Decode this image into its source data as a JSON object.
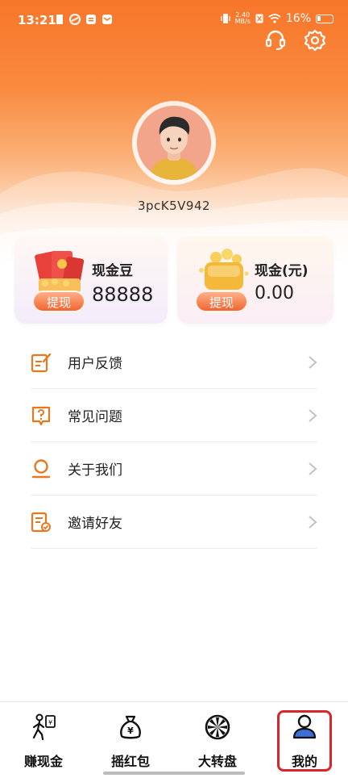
{
  "status_bar": {
    "time": "13:21",
    "net_speed_value": "2.40",
    "net_speed_unit": "MB/s",
    "battery": "16%"
  },
  "profile": {
    "username": "3pcK5V942"
  },
  "cards": {
    "beans": {
      "label": "现金豆",
      "value": "88888",
      "button": "提现"
    },
    "cash": {
      "label": "现金(元)",
      "value": "0.00",
      "button": "提现"
    }
  },
  "menu": {
    "items": [
      {
        "label": "用户反馈",
        "icon": "feedback-icon"
      },
      {
        "label": "常见问题",
        "icon": "faq-icon"
      },
      {
        "label": "关于我们",
        "icon": "about-icon"
      },
      {
        "label": "邀请好友",
        "icon": "invite-icon"
      }
    ]
  },
  "nav": {
    "items": [
      {
        "label": "赚现金",
        "icon": "walking-person-icon"
      },
      {
        "label": "摇红包",
        "icon": "money-bag-icon"
      },
      {
        "label": "大转盘",
        "icon": "wheel-icon"
      },
      {
        "label": "我的",
        "icon": "user-icon",
        "active": true
      }
    ]
  },
  "colors": {
    "accent": "#f2652f",
    "header_top": "#f8762a",
    "active_highlight": "#d8262b",
    "nav_user_icon": "#3b6fd6"
  }
}
